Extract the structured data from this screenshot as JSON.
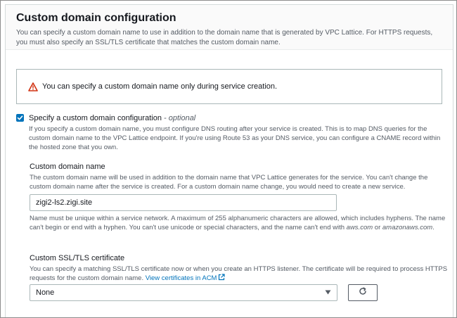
{
  "panel": {
    "title": "Custom domain configuration",
    "description": "You can specify a custom domain name to use in addition to the domain name that is generated by VPC Lattice. For HTTPS requests, you must also specify an SSL/TLS certificate that matches the custom domain name."
  },
  "alert": {
    "icon": "warning-icon",
    "text": "You can specify a custom domain name only during service creation."
  },
  "custom_domain_checkbox": {
    "checked": true,
    "label": "Specify a custom domain configuration",
    "optional_tag": "- optional",
    "description": "If you specify a custom domain name, you must configure DNS routing after your service is created. This is to map DNS queries for the custom domain name to the VPC Lattice endpoint. If you're using Route 53 as your DNS service, you can configure a CNAME record within the hosted zone that you own."
  },
  "domain_name_field": {
    "label": "Custom domain name",
    "description": "The custom domain name will be used in addition to the domain name that VPC Lattice generates for the service. You can't change the custom domain name after the service is created. For a custom domain name change, you would need to create a new service.",
    "value": "zigi2-ls2.zigi.site",
    "constraint_prefix": "Name must be unique within a service network. A maximum of 255 alphanumeric characters are allowed, which includes hyphens. The name can't begin or end with a hyphen. You can't use unicode or special characters, and the name can't end with ",
    "constraint_domain1": "aws.com",
    "constraint_or": " or ",
    "constraint_domain2": "amazonaws.com",
    "constraint_end": "."
  },
  "certificate_field": {
    "label": "Custom SSL/TLS certificate",
    "description": "You can specify a matching SSL/TLS certificate now or when you create an HTTPS listener. The certificate will be required to process HTTPS requests for the custom domain name. ",
    "link_text": "View certificates in ACM",
    "selected": "None"
  },
  "colors": {
    "accent": "#0073bb",
    "warning": "#d13212",
    "text": "#16191f",
    "secondary_text": "#545b64"
  }
}
